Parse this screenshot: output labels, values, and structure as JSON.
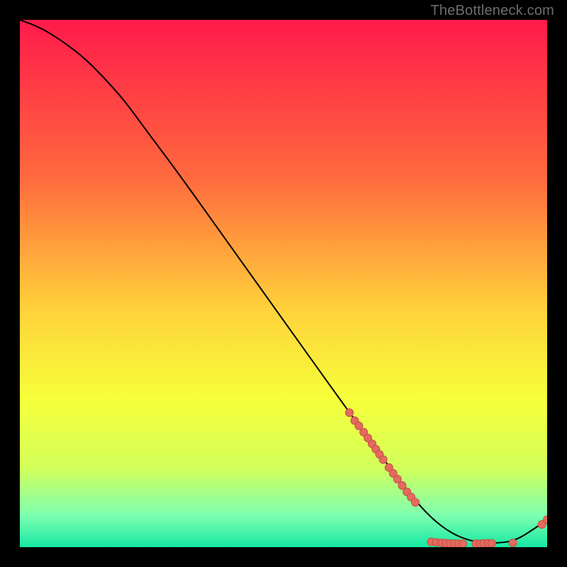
{
  "watermark": "TheBottleneck.com",
  "colors": {
    "bg_black": "#000000",
    "curve": "#000000",
    "point_fill": "#e46a5e",
    "point_stroke": "#c44f45",
    "grad_top": "#ff1a4b",
    "grad_mid1": "#ff6a3e",
    "grad_mid2": "#ffd23a",
    "grad_mid3": "#f6ff3a",
    "grad_low1": "#d2ff5a",
    "grad_low2": "#7dffb0",
    "grad_bottom": "#16e8a3"
  },
  "chart_data": {
    "type": "line",
    "title": "",
    "xlabel": "",
    "ylabel": "",
    "xlim": [
      0,
      100
    ],
    "ylim": [
      0,
      100
    ],
    "series": [
      {
        "name": "curve",
        "x": [
          0,
          4,
          8,
          12,
          16,
          20,
          24,
          30,
          40,
          50,
          60,
          68,
          74,
          78,
          82,
          86,
          90,
          94,
          98,
          100
        ],
        "y": [
          100,
          98.5,
          96,
          93,
          89,
          84.5,
          79,
          71,
          57,
          43,
          29,
          18,
          10,
          5.5,
          2.5,
          1,
          0.7,
          1.2,
          3.8,
          5.2
        ]
      }
    ],
    "points": [
      {
        "x": 62.5,
        "y": 25.5
      },
      {
        "x": 63.5,
        "y": 24.0
      },
      {
        "x": 64.3,
        "y": 23.0
      },
      {
        "x": 65.2,
        "y": 21.8
      },
      {
        "x": 66.0,
        "y": 20.7
      },
      {
        "x": 66.8,
        "y": 19.6
      },
      {
        "x": 67.5,
        "y": 18.6
      },
      {
        "x": 68.2,
        "y": 17.6
      },
      {
        "x": 68.9,
        "y": 16.6
      },
      {
        "x": 70.0,
        "y": 15.1
      },
      {
        "x": 70.8,
        "y": 14.0
      },
      {
        "x": 71.6,
        "y": 12.9
      },
      {
        "x": 72.5,
        "y": 11.7
      },
      {
        "x": 73.4,
        "y": 10.5
      },
      {
        "x": 74.2,
        "y": 9.5
      },
      {
        "x": 75.0,
        "y": 8.5
      },
      {
        "x": 78.0,
        "y": 1.0
      },
      {
        "x": 79.0,
        "y": 0.9
      },
      {
        "x": 80.0,
        "y": 0.8
      },
      {
        "x": 80.8,
        "y": 0.75
      },
      {
        "x": 81.6,
        "y": 0.7
      },
      {
        "x": 82.4,
        "y": 0.68
      },
      {
        "x": 83.2,
        "y": 0.66
      },
      {
        "x": 84.0,
        "y": 0.65
      },
      {
        "x": 86.5,
        "y": 0.66
      },
      {
        "x": 87.3,
        "y": 0.68
      },
      {
        "x": 88.0,
        "y": 0.7
      },
      {
        "x": 88.8,
        "y": 0.72
      },
      {
        "x": 89.5,
        "y": 0.74
      },
      {
        "x": 93.5,
        "y": 0.8
      },
      {
        "x": 99.0,
        "y": 4.3
      },
      {
        "x": 100.0,
        "y": 5.2
      }
    ],
    "gradient_stops": [
      {
        "offset": 0.0,
        "key": "grad_top"
      },
      {
        "offset": 0.3,
        "key": "grad_mid1"
      },
      {
        "offset": 0.55,
        "key": "grad_mid2"
      },
      {
        "offset": 0.72,
        "key": "grad_mid3"
      },
      {
        "offset": 0.85,
        "key": "grad_low1"
      },
      {
        "offset": 0.94,
        "key": "grad_low2"
      },
      {
        "offset": 1.0,
        "key": "grad_bottom"
      }
    ]
  }
}
